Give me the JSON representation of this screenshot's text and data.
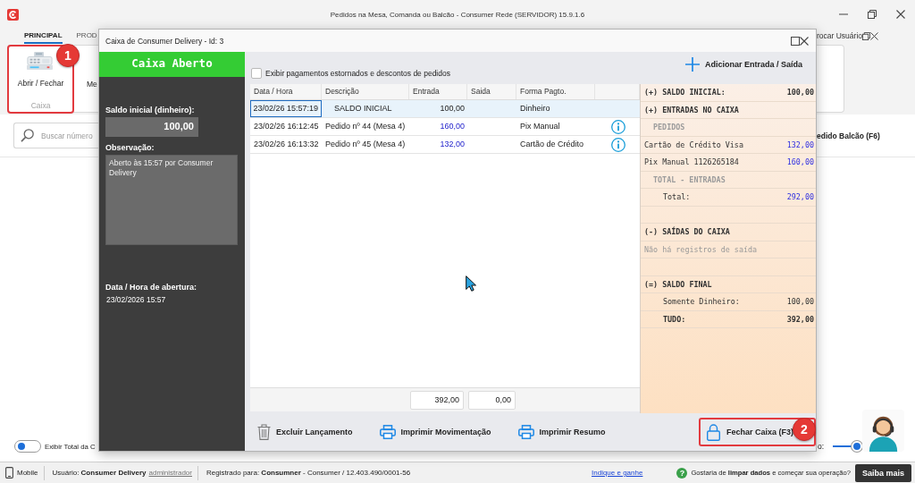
{
  "app": {
    "title": "Pedidos na Mesa, Comanda ou Balcão - Consumer Rede (SERVIDOR) 15.9.1.6"
  },
  "ribbon": {
    "tabs": [
      {
        "label": "PRINCIPAL",
        "selected": true
      },
      {
        "label": "PROD",
        "selected": false
      }
    ],
    "user_switch": "rocar Usuário",
    "group": {
      "label": "Caixa",
      "button": "Abrir / Fechar",
      "callout": "1"
    },
    "next_button": "Me"
  },
  "search": {
    "placeholder": "Buscar número"
  },
  "order_button": "edido Balcão (F6)",
  "footer_controls": {
    "toggle": {
      "label": "Exibir Total da C",
      "on": false
    },
    "slider": {
      "label": "o:",
      "level": 0.8
    }
  },
  "status_bar": {
    "device": "Mobile",
    "user": "Usuário: **Consumer Delivery**",
    "role": "administrador",
    "registration": "Registrado para: **Consumner** - Consumer / 12.403.490/0001-56",
    "referral": "Indique e ganhe",
    "help_glyph": "?",
    "prompt": "Gostaria de **limpar dados** e começar sua operação?",
    "prompt_button": "Saiba mais"
  },
  "dialog": {
    "title": "Caixa de Consumer Delivery - Id: 3",
    "status": {
      "label": "Caixa Aberto",
      "open": true
    },
    "opening_balance": {
      "label": "Saldo inicial (dinheiro):",
      "value": "100,00"
    },
    "note": {
      "label": "Observação:",
      "value": "Aberto às 15:57 por Consumer Delivery"
    },
    "opened_at": {
      "label": "Data / Hora de abertura:",
      "value": "23/02/2026 15:57"
    },
    "filter": {
      "label": "Exibir pagamentos estornados e descontos de pedidos",
      "checked": false
    },
    "add_button": "Adicionar Entrada / Saída",
    "table": {
      "columns": [
        "Data / Hora",
        "Descrição",
        "Entrada",
        "Saida",
        "Forma Pagto."
      ],
      "rows": [
        {
          "kind": "opening",
          "date": "23/02/26 15:57:19",
          "description": "SALDO INICIAL",
          "entrada": "100,00",
          "payment": "Dinheiro",
          "selected": true
        },
        {
          "kind": "order",
          "date": "23/02/26 16:12:45",
          "description": "Pedido nº 44 (Mesa 4)",
          "entrada": "160,00",
          "payment": "Pix Manual",
          "selected": false
        },
        {
          "kind": "order",
          "date": "23/02/26 16:13:32",
          "description": "Pedido nº 45 (Mesa 4)",
          "entrada": "132,00",
          "payment": "Cartão de Crédito",
          "selected": false
        }
      ],
      "totals": {
        "entrada": "392,00",
        "saida": "0,00"
      }
    },
    "summary": [
      {
        "kind": "section",
        "label": "(+) SALDO INICIAL:",
        "value": "100,00",
        "highlight": false
      },
      {
        "kind": "section",
        "label": "(+) ENTRADAS NO CAIXA"
      },
      {
        "kind": "group",
        "label": "PEDIDOS"
      },
      {
        "kind": "entry",
        "label": "Cartão de Crédito Visa",
        "value": "132,00",
        "highlight": true
      },
      {
        "kind": "entry",
        "label": "Pix Manual 1126265184",
        "value": "160,00",
        "highlight": true
      },
      {
        "kind": "group",
        "label": "TOTAL - ENTRADAS"
      },
      {
        "kind": "subtotal",
        "label": "Total:",
        "value": "292,00",
        "highlight": true,
        "emphasis": false
      },
      {
        "kind": "spacer"
      },
      {
        "kind": "section",
        "label": "(-) SAÍDAS DO CAIXA"
      },
      {
        "kind": "note",
        "label": "Não há registros de saída"
      },
      {
        "kind": "spacer"
      },
      {
        "kind": "section",
        "label": "(=) SALDO FINAL"
      },
      {
        "kind": "subtotal",
        "label": "Somente Dinheiro:",
        "value": "100,00",
        "highlight": false,
        "emphasis": false
      },
      {
        "kind": "subtotal",
        "label": "TUDO:",
        "value": "392,00",
        "highlight": false,
        "emphasis": true
      }
    ],
    "actions": [
      {
        "kind": "delete",
        "label": "Excluir Lançamento"
      },
      {
        "kind": "print",
        "label": "Imprimir Movimentação"
      },
      {
        "kind": "print",
        "label": "Imprimir Resumo"
      }
    ],
    "close_button": {
      "label": "Fechar Caixa (F3)",
      "callout": "2"
    }
  }
}
